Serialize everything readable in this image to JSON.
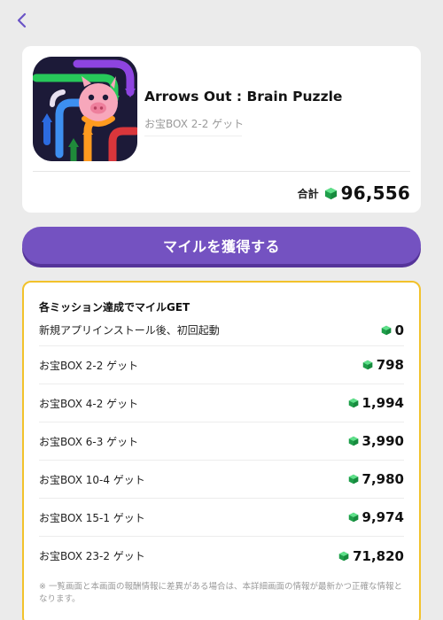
{
  "nav": {
    "back_icon": "chevron-left-icon"
  },
  "app": {
    "name": "Arrows Out : Brain Puzzle",
    "subtitle": "お宝BOX 2-2 ゲット",
    "icon": "arrows-out-app-icon"
  },
  "total": {
    "label": "合計",
    "value": "96,556",
    "icon": "green-gem-icon"
  },
  "cta": {
    "label": "マイルを獲得する",
    "color": "#7452c1"
  },
  "missions": {
    "title": "各ミッション達成でマイルGET",
    "items": [
      {
        "label": "新規アプリインストール後、初回起動",
        "value": "0"
      },
      {
        "label": "お宝BOX 2-2 ゲット",
        "value": "798"
      },
      {
        "label": "お宝BOX 4-2 ゲット",
        "value": "1,994"
      },
      {
        "label": "お宝BOX 6-3 ゲット",
        "value": "3,990"
      },
      {
        "label": "お宝BOX 10-4 ゲット",
        "value": "7,980"
      },
      {
        "label": "お宝BOX 15-1 ゲット",
        "value": "9,974"
      },
      {
        "label": "お宝BOX 23-2 ゲット",
        "value": "71,820"
      }
    ],
    "note": "※ 一覧画面と本画面の報酬情報に差異がある場合は、本詳細画面の情報が最新かつ正確な情報となります。",
    "border_color": "#f2c22b"
  }
}
